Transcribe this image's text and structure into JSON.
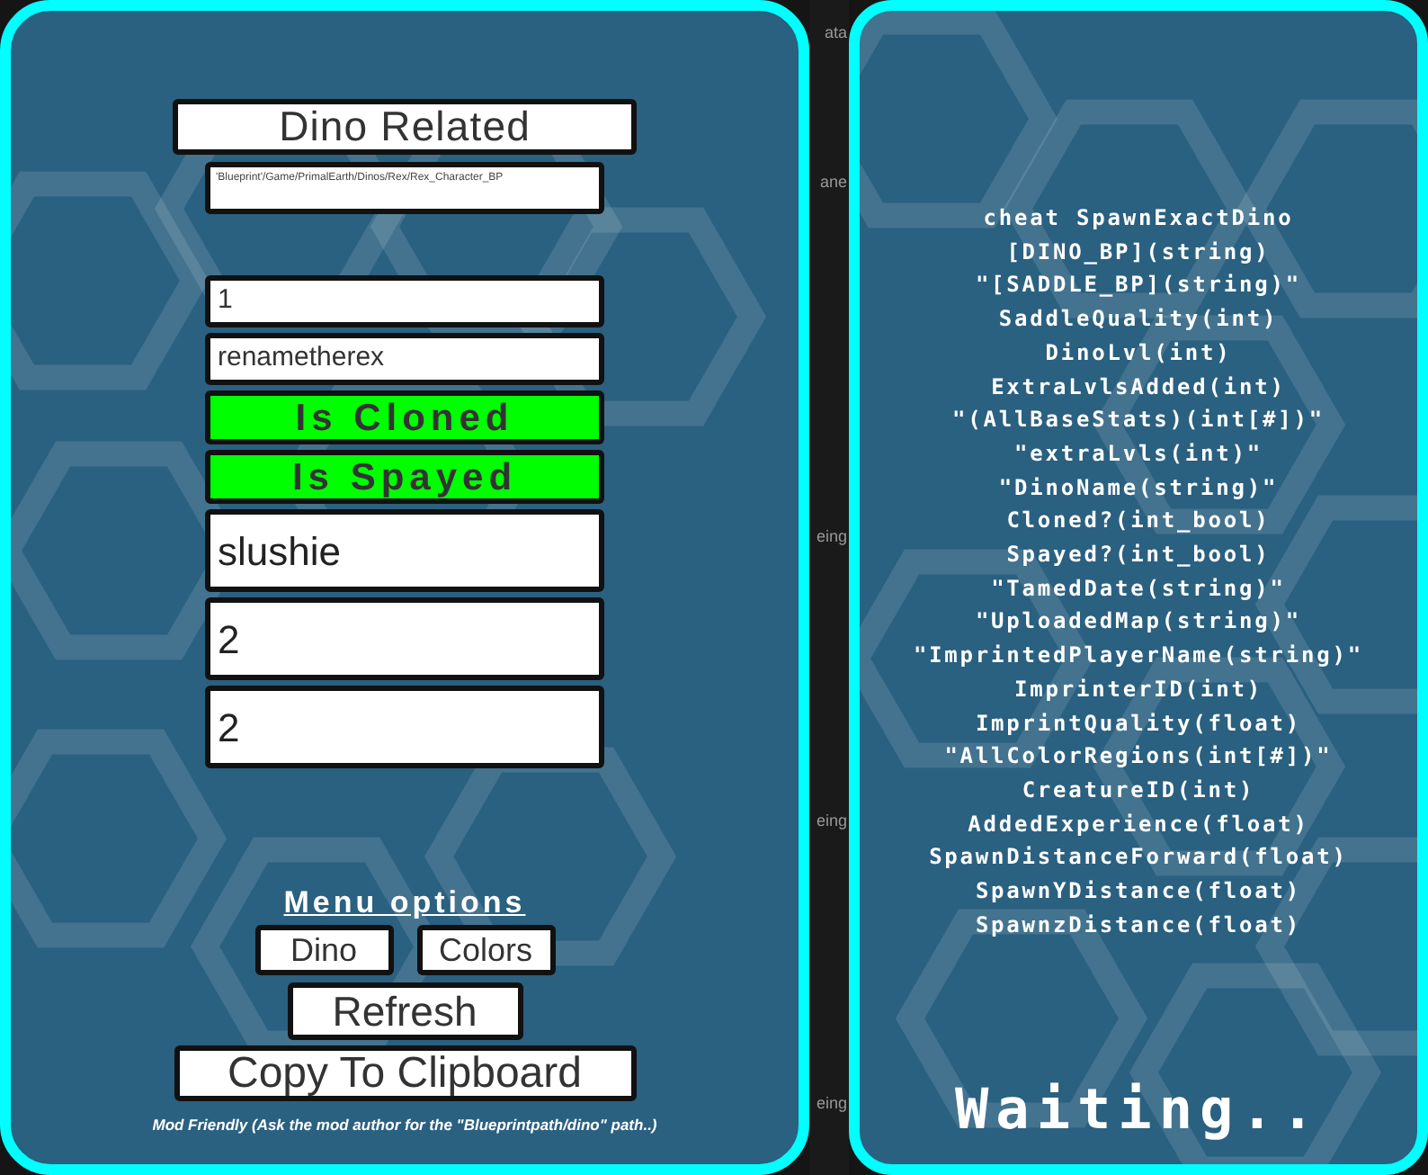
{
  "dino_panel": {
    "title": "Dino Related",
    "blueprint_field": {
      "value": "'Blueprint'/Game/PrimalEarth/Dinos/Rex/Rex_Character_BP"
    },
    "fields": [
      {
        "kind": "small",
        "value": "1"
      },
      {
        "kind": "small",
        "value": "renametherex"
      },
      {
        "kind": "toggle",
        "label": "Is Cloned",
        "on": true
      },
      {
        "kind": "toggle",
        "label": "Is Spayed",
        "on": true
      },
      {
        "kind": "large",
        "value": "slushie"
      },
      {
        "kind": "large",
        "value": "2"
      },
      {
        "kind": "large",
        "value": "2"
      }
    ],
    "menu_heading": "Menu options",
    "menu_buttons": [
      "Dino",
      "Colors"
    ],
    "refresh_button": "Refresh",
    "copy_button": "Copy To Clipboard",
    "note": "Mod Friendly (Ask the mod author for the \"Blueprintpath/dino\" path..)"
  },
  "background_strip": [
    "ata",
    "ane",
    "eing",
    "eing",
    "eing"
  ],
  "command_panel": {
    "lines": [
      "cheat SpawnExactDino",
      "[DINO_BP](string)",
      "\"[SADDLE_BP](string)\"",
      "SaddleQuality(int)",
      "DinoLvl(int)",
      "ExtraLvlsAdded(int)",
      "\"(AllBaseStats)(int[#])\"",
      "\"extraLvls(int)\"",
      "\"DinoName(string)\"",
      "Cloned?(int_bool)",
      "Spayed?(int_bool)",
      "\"TamedDate(string)\"",
      "\"UploadedMap(string)\"",
      "\"ImprintedPlayerName(string)\"",
      "ImprinterID(int)",
      "ImprintQuality(float)",
      "\"AllColorRegions(int[#])\"",
      "CreatureID(int)",
      "AddedExperience(float)",
      "SpawnDistanceForward(float)",
      "SpawnYDistance(float)",
      "SpawnzDistance(float)"
    ],
    "status": "Waiting.."
  }
}
